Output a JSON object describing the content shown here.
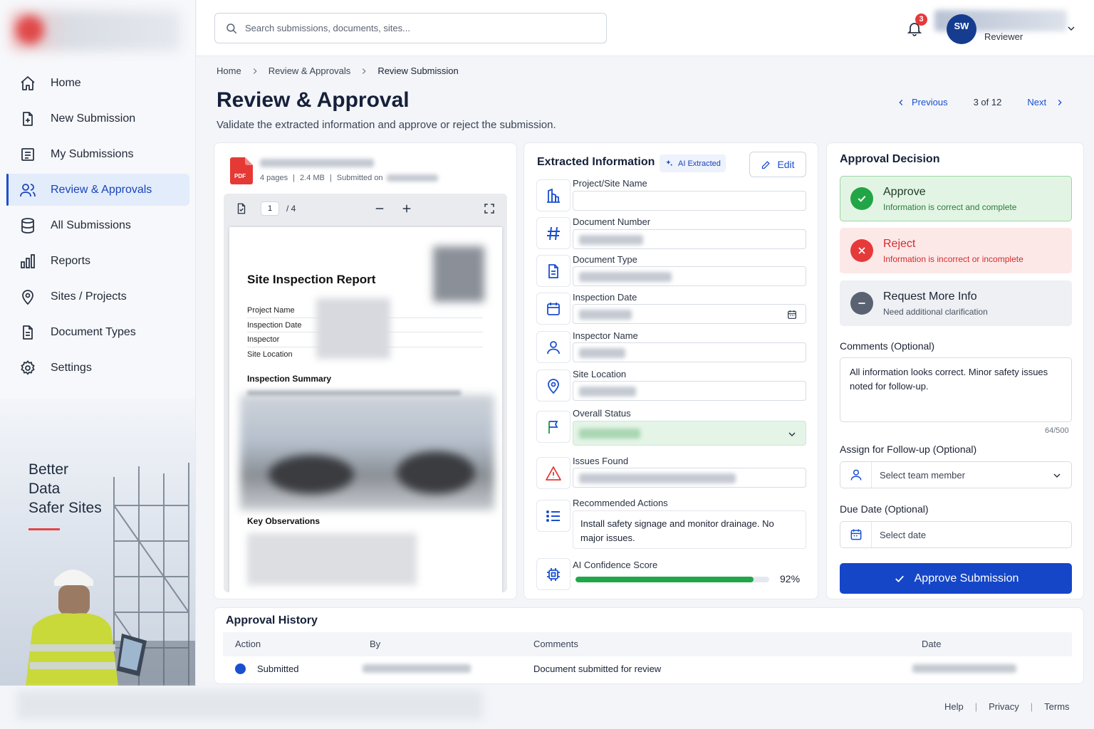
{
  "sidebar": {
    "items": [
      {
        "label": "Home",
        "icon": "home-icon"
      },
      {
        "label": "New Submission",
        "icon": "file-plus-icon"
      },
      {
        "label": "My Submissions",
        "icon": "list-doc-icon"
      },
      {
        "label": "Review & Approvals",
        "icon": "user-check-icon",
        "active": true
      },
      {
        "label": "All Submissions",
        "icon": "database-icon"
      },
      {
        "label": "Reports",
        "icon": "bar-chart-icon"
      },
      {
        "label": "Sites / Projects",
        "icon": "map-pin-icon"
      },
      {
        "label": "Document Types",
        "icon": "document-icon"
      },
      {
        "label": "Settings",
        "icon": "gear-icon"
      }
    ],
    "tagline": [
      "Better",
      "Data",
      "Safer Sites"
    ]
  },
  "header": {
    "search_placeholder": "Search submissions, documents, sites...",
    "notifications": "3",
    "avatar_initials": "SW",
    "user_role": "Reviewer"
  },
  "breadcrumb": [
    "Home",
    "Review & Approvals",
    "Review Submission"
  ],
  "page": {
    "title": "Review & Approval",
    "subtitle": "Validate the extracted information and approve or reject the submission."
  },
  "pager": {
    "previous": "Previous",
    "position": "3 of 12",
    "next": "Next"
  },
  "document": {
    "pages": "4 pages",
    "size": "2.4 MB",
    "submitted_prefix": "Submitted on",
    "viewer_page": "1",
    "viewer_total": "/ 4",
    "report": {
      "title": "Site Inspection Report",
      "rows": [
        "Project Name",
        "Inspection Date",
        "Inspector",
        "Site Location"
      ],
      "summary_heading": "Inspection Summary",
      "observations_heading": "Key Observations"
    }
  },
  "extracted": {
    "title": "Extracted Information",
    "ai_tag": "AI Extracted",
    "edit_label": "Edit",
    "fields": {
      "project": "Project/Site Name",
      "doc_number": "Document Number",
      "doc_type": "Document Type",
      "inspection_date": "Inspection Date",
      "inspector": "Inspector Name",
      "site_location": "Site Location",
      "overall_status": "Overall Status",
      "issues_found": "Issues Found",
      "recommended_actions": "Recommended Actions",
      "confidence": "AI Confidence Score"
    },
    "recommended_actions_value": "Install safety signage and monitor drainage. No major issues.",
    "confidence_value": "92%",
    "confidence_fraction": 0.92
  },
  "decision": {
    "title": "Approval Decision",
    "approve": {
      "label": "Approve",
      "desc": "Information is correct and complete"
    },
    "reject": {
      "label": "Reject",
      "desc": "Information is incorrect or incomplete"
    },
    "more_info": {
      "label": "Request More Info",
      "desc": "Need additional clarification"
    },
    "comments_label": "Comments (Optional)",
    "comments_value": "All information looks correct. Minor safety issues noted for follow-up.",
    "comments_count": "64/500",
    "assign_label": "Assign for Follow-up (Optional)",
    "assign_placeholder": "Select team member",
    "due_label": "Due Date (Optional)",
    "due_placeholder": "Select date",
    "approve_button": "Approve Submission"
  },
  "history": {
    "title": "Approval History",
    "columns": [
      "Action",
      "By",
      "Comments",
      "Date"
    ],
    "rows": [
      {
        "action": "Submitted",
        "comments": "Document submitted for review"
      }
    ]
  },
  "footer": {
    "links": [
      "Help",
      "Privacy",
      "Terms"
    ]
  },
  "colors": {
    "accent": "#1a4fd0",
    "approve": "#22a546",
    "reject": "#e63a3a",
    "alert": "#e5393a"
  }
}
